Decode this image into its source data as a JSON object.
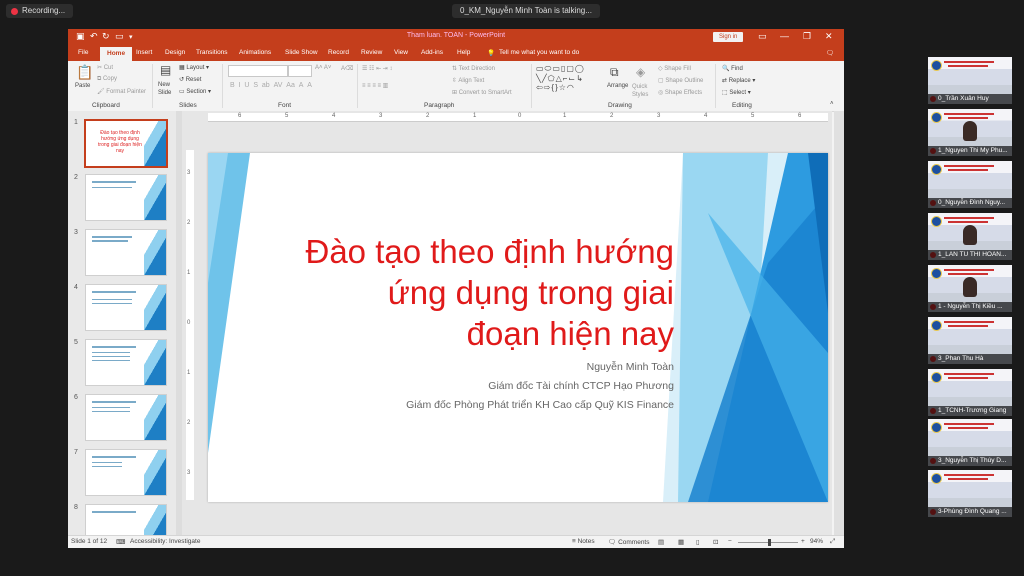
{
  "zoom": {
    "recording_label": "Recording...",
    "talking_label": "0_KM_Nguyễn Minh Toàn is talking..."
  },
  "window": {
    "title": "Tham luan. TOAN  -  PowerPoint",
    "sign_in": "Sign in",
    "accent_color": "#c43e1c"
  },
  "tabs": [
    "File",
    "Home",
    "Insert",
    "Design",
    "Transitions",
    "Animations",
    "Slide Show",
    "Record",
    "Review",
    "View",
    "Add-ins",
    "Help"
  ],
  "tell_me": "Tell me what you want to do",
  "ribbon": {
    "clipboard": {
      "paste": "Paste",
      "cut": "Cut",
      "copy": "Copy",
      "format_painter": "Format Painter",
      "label": "Clipboard"
    },
    "slides": {
      "new_slide": "New Slide",
      "layout": "Layout",
      "reset": "Reset",
      "section": "Section",
      "label": "Slides"
    },
    "font": {
      "label": "Font"
    },
    "paragraph": {
      "text_direction": "Text Direction",
      "align_text": "Align Text",
      "convert_smartart": "Convert to SmartArt",
      "label": "Paragraph"
    },
    "drawing": {
      "arrange": "Arrange",
      "quick_styles": "Quick Styles",
      "shape_fill": "Shape Fill",
      "shape_outline": "Shape Outline",
      "shape_effects": "Shape Effects",
      "label": "Drawing"
    },
    "editing": {
      "find": "Find",
      "replace": "Replace",
      "select": "Select",
      "label": "Editing"
    }
  },
  "thumbnails": [
    {
      "num": "1",
      "title": "Đào tạo theo định hướng ứng dụng trong giai đoạn hiện nay"
    },
    {
      "num": "2"
    },
    {
      "num": "3"
    },
    {
      "num": "4"
    },
    {
      "num": "5"
    },
    {
      "num": "6"
    },
    {
      "num": "7"
    },
    {
      "num": "8"
    }
  ],
  "ruler": {
    "h": [
      "6",
      "5",
      "4",
      "3",
      "2",
      "1",
      "0",
      "1",
      "2",
      "3",
      "4",
      "5",
      "6"
    ],
    "v": [
      "3",
      "2",
      "1",
      "0",
      "1",
      "2",
      "3"
    ]
  },
  "slide": {
    "title_lines": [
      "Đào tạo theo định hướng",
      "ứng dụng trong giai",
      "đoạn hiện nay"
    ],
    "author": "Nguyễn Minh Toàn",
    "role1": "Giám đốc Tài chính CTCP Hạo Phương",
    "role2": "Giám đốc Phòng Phát triển KH Cao cấp Quỹ KIS Finance",
    "title_color": "#e01a1a"
  },
  "status": {
    "slide_count": "Slide 1 of 12",
    "accessibility": "Accessibility: Investigate",
    "notes": "Notes",
    "comments": "Comments",
    "zoom": "94%"
  },
  "participants": [
    {
      "name": "0_Trần Xuân Huy"
    },
    {
      "name": "1_Nguyen Thi My Phu..."
    },
    {
      "name": "0_Nguyễn Đình Nguy..."
    },
    {
      "name": "1_LAN TU THI HOAN..."
    },
    {
      "name": "1 - Nguyễn Thị Kiều ..."
    },
    {
      "name": "3_Phan Thu Hà"
    },
    {
      "name": "1_TCNH-Trương Giang"
    },
    {
      "name": "3_Nguyễn Thị Thúy D..."
    },
    {
      "name": "3-Phùng Đình Quang ..."
    }
  ]
}
